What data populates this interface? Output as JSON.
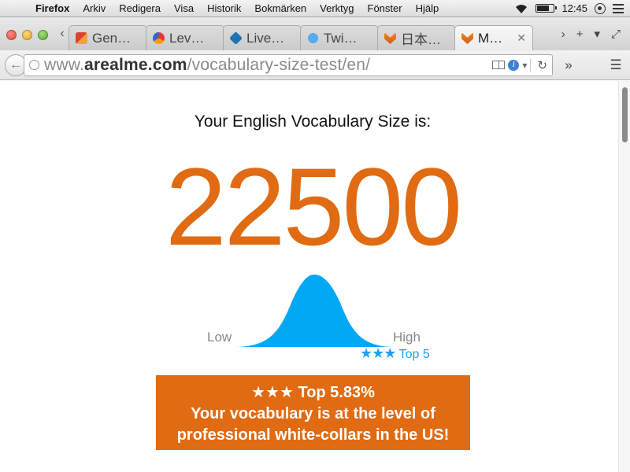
{
  "menubar": {
    "app": "Firefox",
    "items": [
      "Arkiv",
      "Redigera",
      "Visa",
      "Historik",
      "Bokmärken",
      "Verktyg",
      "Fönster",
      "Hjälp"
    ],
    "clock": "12:45"
  },
  "tabs": [
    {
      "label": "Gen…",
      "icon": "gen-favicon"
    },
    {
      "label": "Lev…",
      "icon": "lev-favicon"
    },
    {
      "label": "Live…",
      "icon": "live-favicon"
    },
    {
      "label": "Twi…",
      "icon": "twitter-favicon"
    },
    {
      "label": "日本…",
      "icon": "firefox-favicon"
    },
    {
      "label": "M…",
      "icon": "firefox-favicon",
      "active": true
    }
  ],
  "url": {
    "prefix": "www.",
    "domain": "arealme.com",
    "path": "/vocabulary-size-test/en/"
  },
  "result": {
    "heading": "Your English Vocabulary Size is:",
    "score": "22500",
    "low_label": "Low",
    "high_label": "High",
    "marker_stars": "★★★",
    "marker_text": "Top 5",
    "box_stars_line": "★★★ Top 5.83%",
    "box_line_1": "Your vocabulary is at the level of",
    "box_line_2": "professional white-collars in the US!"
  },
  "colors": {
    "accent": "#e06b12",
    "curve": "#00a8f3"
  }
}
